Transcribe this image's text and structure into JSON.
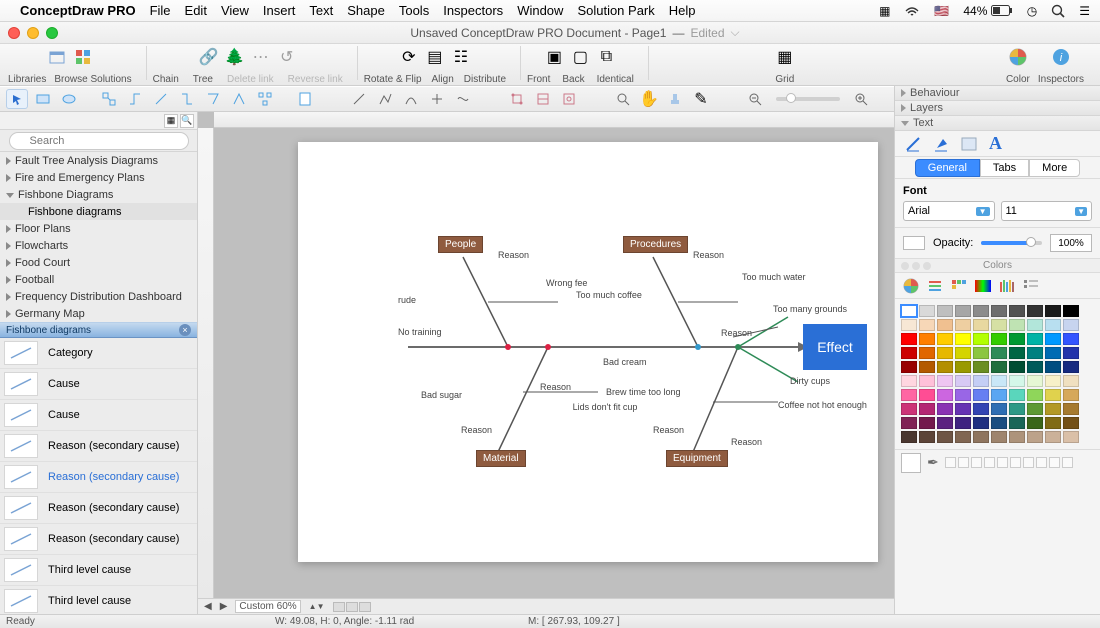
{
  "menubar": {
    "appname": "ConceptDraw PRO",
    "items": [
      "File",
      "Edit",
      "View",
      "Insert",
      "Text",
      "Shape",
      "Tools",
      "Inspectors",
      "Window",
      "Solution Park",
      "Help"
    ],
    "battery": "44%"
  },
  "titlebar": {
    "doc": "Unsaved ConceptDraw PRO Document - Page1",
    "dash": "—",
    "edited": "Edited"
  },
  "toolbar": {
    "libraries": "Libraries",
    "browse": "Browse Solutions",
    "chain": "Chain",
    "tree": "Tree",
    "deletelink": "Delete link",
    "reverselink": "Reverse link",
    "rotateflip": "Rotate & Flip",
    "align": "Align",
    "distribute": "Distribute",
    "front": "Front",
    "back": "Back",
    "identical": "Identical",
    "grid": "Grid",
    "color": "Color",
    "inspectors": "Inspectors"
  },
  "leftpanel": {
    "search_placeholder": "Search",
    "libs": [
      {
        "label": "Fault Tree Analysis Diagrams",
        "open": false
      },
      {
        "label": "Fire and Emergency Plans",
        "open": false
      },
      {
        "label": "Fishbone Diagrams",
        "open": true,
        "sub": "Fishbone diagrams"
      },
      {
        "label": "Floor Plans",
        "open": false
      },
      {
        "label": "Flowcharts",
        "open": false
      },
      {
        "label": "Food Court",
        "open": false
      },
      {
        "label": "Football",
        "open": false
      },
      {
        "label": "Frequency Distribution Dashboard",
        "open": false
      },
      {
        "label": "Germany Map",
        "open": false
      }
    ],
    "tabname": "Fishbone diagrams",
    "stencils": [
      {
        "label": "Category"
      },
      {
        "label": "Cause"
      },
      {
        "label": "Cause"
      },
      {
        "label": "Reason (secondary cause)"
      },
      {
        "label": "Reason (secondary cause)",
        "sel": true
      },
      {
        "label": "Reason (secondary cause)"
      },
      {
        "label": "Reason (secondary cause)"
      },
      {
        "label": "Third level cause"
      },
      {
        "label": "Third level cause"
      }
    ]
  },
  "diagram": {
    "effect": "Effect",
    "cats": {
      "people": "People",
      "procedures": "Procedures",
      "material": "Material",
      "equipment": "Equipment"
    },
    "labels": {
      "reason": "Reason",
      "rude": "rude",
      "notraining": "No training",
      "wrongfee": "Wrong fee",
      "toomuchcoffee": "Too much coffee",
      "toomuchwater": "Too much water",
      "toomanygrounds": "Too many grounds",
      "badcream": "Bad cream",
      "dirtycups": "Dirty cups",
      "badsugar": "Bad sugar",
      "lidsdontfit": "Lids don't fit cup",
      "brewtime": "Brew time too long",
      "coffeenothot": "Coffee not hot enough"
    }
  },
  "canvas_bottom": {
    "zoom": "Custom 60%"
  },
  "rightpanel": {
    "behaviour": "Behaviour",
    "layers": "Layers",
    "text": "Text",
    "tabs": {
      "general": "General",
      "tabs": "Tabs",
      "more": "More"
    },
    "fontlabel": "Font",
    "fontname": "Arial",
    "fontsize": "11",
    "opacitylabel": "Opacity:",
    "opacityval": "100%",
    "colorshdr": "Colors"
  },
  "status": {
    "ready": "Ready",
    "wh": "W: 49.08,  H: 0,  Angle: -1.11 rad",
    "mouse": "M: [ 267.93, 109.27 ]"
  },
  "swatch_rows": [
    [
      "#ffffff",
      "#d9d9d9",
      "#bfbfbf",
      "#a6a6a6",
      "#8c8c8c",
      "#6e6e6e",
      "#525252",
      "#333333",
      "#1a1a1a",
      "#000000"
    ],
    [
      "#f7e7d5",
      "#f7d7b7",
      "#f0c090",
      "#eecfa1",
      "#e8d8a0",
      "#d6e0a4",
      "#bfe3b3",
      "#b2e6da",
      "#b8dff0",
      "#c7d4ef"
    ],
    [
      "#ff0000",
      "#ff7f00",
      "#ffcc00",
      "#ffff00",
      "#b3ff00",
      "#33cc00",
      "#009933",
      "#00b3a6",
      "#0099ff",
      "#3355ff"
    ],
    [
      "#cc0000",
      "#e06600",
      "#e6b800",
      "#d4d400",
      "#8cc63f",
      "#2e8b57",
      "#006644",
      "#008080",
      "#006bb3",
      "#2233aa"
    ],
    [
      "#990000",
      "#b35900",
      "#b38f00",
      "#999900",
      "#6b8e23",
      "#1f6e3c",
      "#004d33",
      "#005a5a",
      "#004d80",
      "#172b80"
    ],
    [
      "#ffd6e0",
      "#ffc0d9",
      "#eec5f2",
      "#d7c9f4",
      "#c4cef5",
      "#c9e7f7",
      "#d4f7e9",
      "#e6f7d4",
      "#f7f0c8",
      "#f0e0c0"
    ],
    [
      "#ff66a3",
      "#ff4d94",
      "#cc66e0",
      "#9966e6",
      "#667ff2",
      "#5aa6f2",
      "#5ad6bc",
      "#8fd65a",
      "#e0d24d",
      "#d6a85a"
    ],
    [
      "#cc3377",
      "#b32673",
      "#8a33b3",
      "#6633b3",
      "#3344b3",
      "#2e6eb3",
      "#2e9986",
      "#5e9933",
      "#b39926",
      "#a67a2e"
    ],
    [
      "#802255",
      "#73194d",
      "#5c2280",
      "#3f2280",
      "#1f2e80",
      "#1a4d80",
      "#1a6658",
      "#3a6619",
      "#806b14",
      "#735016"
    ],
    [
      "#4a3730",
      "#5c4438",
      "#6e5545",
      "#806652",
      "#8f755f",
      "#9e846d",
      "#ad937b",
      "#bca28a",
      "#cbb199",
      "#dac0a8"
    ]
  ]
}
